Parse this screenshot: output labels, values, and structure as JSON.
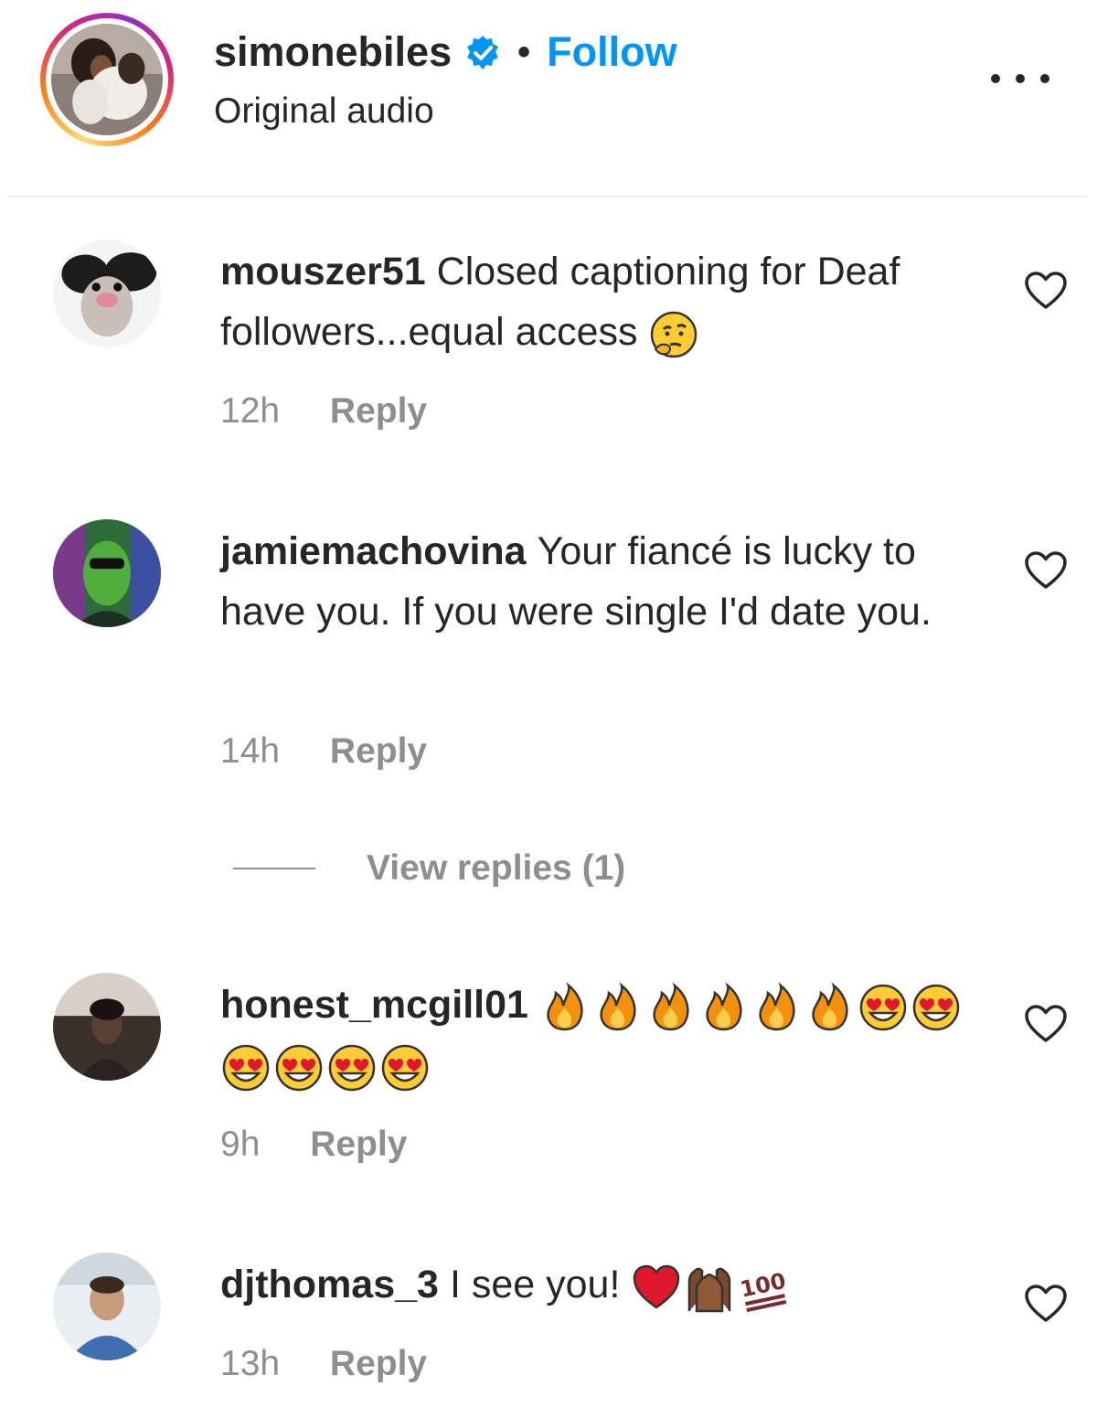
{
  "header": {
    "username": "simonebiles",
    "verified_icon": "verified-badge-icon",
    "separator": "•",
    "follow_label": "Follow",
    "subtitle": "Original audio",
    "more_icon": "more-options-icon"
  },
  "colors": {
    "follow_blue": "#0095f6",
    "verified_blue": "#0095f6",
    "meta_gray": "#8e8e8e",
    "text": "#262626"
  },
  "comments": [
    {
      "username": "mouszer51",
      "text": "Closed captioning for Deaf followers...equal access",
      "emojis": [
        "thinking-face-emoji"
      ],
      "time": "12h",
      "reply_label": "Reply",
      "like_icon": "heart-outline-icon"
    },
    {
      "username": "jamiemachovina",
      "text": "Your fiancé is lucky to have you. If you were single I'd date you.",
      "emojis": [],
      "time": "14h",
      "reply_label": "Reply",
      "like_icon": "heart-outline-icon",
      "view_replies_label": "View replies (1)"
    },
    {
      "username": "honest_mcgill01",
      "text": "",
      "emojis": [
        "fire-emoji",
        "fire-emoji",
        "fire-emoji",
        "fire-emoji",
        "fire-emoji",
        "fire-emoji",
        "heart-eyes-emoji",
        "heart-eyes-emoji",
        "heart-eyes-emoji",
        "heart-eyes-emoji",
        "heart-eyes-emoji",
        "heart-eyes-emoji"
      ],
      "time": "9h",
      "reply_label": "Reply",
      "like_icon": "heart-outline-icon"
    },
    {
      "username": "djthomas_3",
      "text": "I see you!",
      "emojis": [
        "red-heart-emoji",
        "raising-hands-emoji",
        "hundred-points-emoji"
      ],
      "time": "13h",
      "reply_label": "Reply",
      "like_icon": "heart-outline-icon"
    }
  ]
}
